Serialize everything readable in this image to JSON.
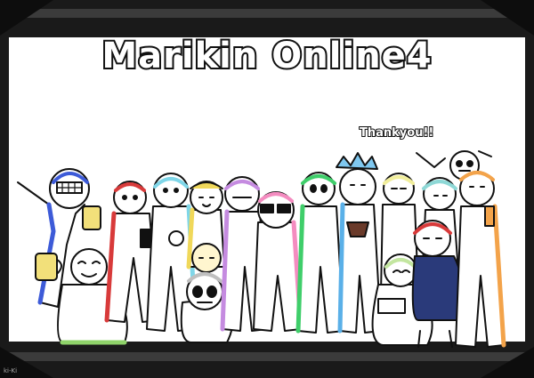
{
  "title": "Marikin Online4",
  "subtitle": "Thankyou!!",
  "signature": "ki-Ki",
  "colors": {
    "frame": "#1a1a1a",
    "stripe": "#3b3b3b",
    "background": "#ffffff",
    "outline": "#111111"
  },
  "characters": [
    {
      "icon": "blue-character-icon",
      "color": "#3d5bd8"
    },
    {
      "icon": "green-character-icon",
      "color": "#c3e6a0"
    },
    {
      "icon": "red-character-icon",
      "color": "#d83a3a"
    },
    {
      "icon": "cyan-character-icon",
      "color": "#7fd6e8"
    },
    {
      "icon": "yellow-character-icon",
      "color": "#f0d85a"
    },
    {
      "icon": "skull-character-icon",
      "color": "#cfcfcf"
    },
    {
      "icon": "purple-character-icon",
      "color": "#c58be0"
    },
    {
      "icon": "pink-character-icon",
      "color": "#f48cc0"
    },
    {
      "icon": "green-character-2-icon",
      "color": "#3fce6a"
    },
    {
      "icon": "crowned-character-icon",
      "color": "#5ab0e8"
    },
    {
      "icon": "pale-yellow-character-icon",
      "color": "#f1ee9c"
    },
    {
      "icon": "teal-character-icon",
      "color": "#8ed8d6"
    },
    {
      "icon": "hooded-character-icon",
      "color": "#2a3a7a"
    },
    {
      "icon": "lilac-character-icon",
      "color": "#e4c8f0"
    },
    {
      "icon": "orange-character-icon",
      "color": "#f3a34a"
    }
  ]
}
